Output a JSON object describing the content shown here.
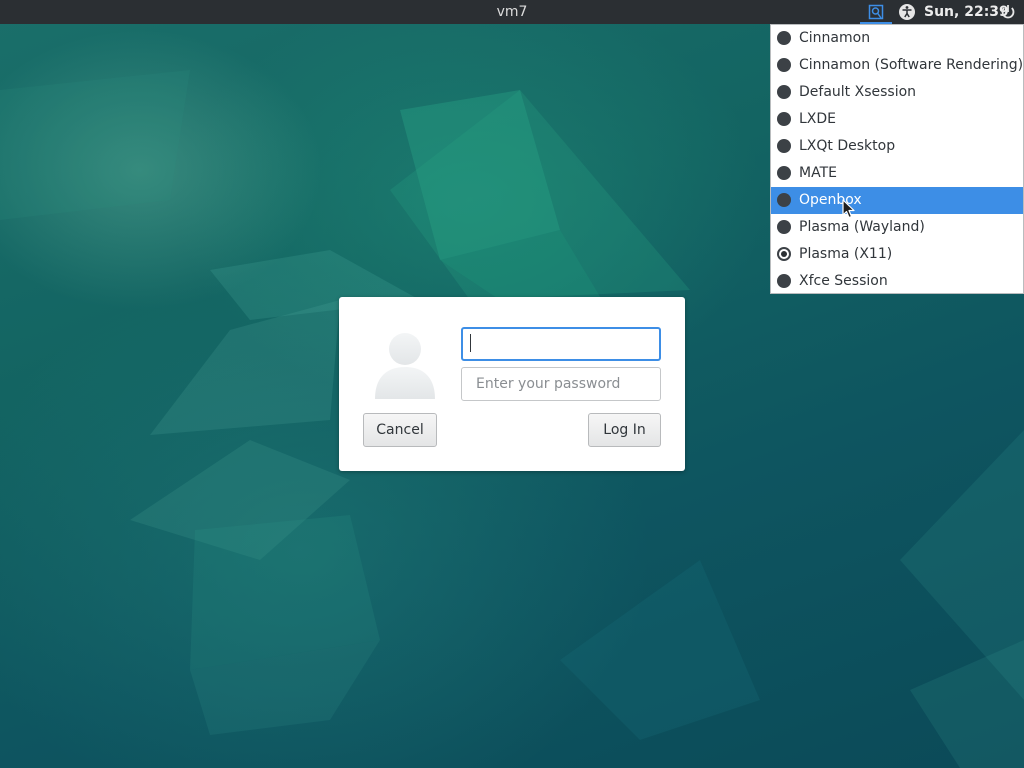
{
  "top_panel": {
    "hostname": "vm7",
    "clock": "Sun, 22:39",
    "icons": [
      "session-chooser-icon",
      "accessibility-icon",
      "power-icon"
    ]
  },
  "session_menu": {
    "items": [
      {
        "label": "Cinnamon",
        "checked": false,
        "highlighted": false
      },
      {
        "label": "Cinnamon (Software Rendering)",
        "checked": false,
        "highlighted": false
      },
      {
        "label": "Default Xsession",
        "checked": false,
        "highlighted": false
      },
      {
        "label": "LXDE",
        "checked": false,
        "highlighted": false
      },
      {
        "label": "LXQt Desktop",
        "checked": false,
        "highlighted": false
      },
      {
        "label": "MATE",
        "checked": false,
        "highlighted": false
      },
      {
        "label": "Openbox",
        "checked": false,
        "highlighted": true
      },
      {
        "label": "Plasma (Wayland)",
        "checked": false,
        "highlighted": false
      },
      {
        "label": "Plasma (X11)",
        "checked": true,
        "highlighted": false
      },
      {
        "label": "Xfce Session",
        "checked": false,
        "highlighted": false
      }
    ]
  },
  "login": {
    "username_value": "",
    "password_placeholder": "Enter your password",
    "cancel_label": "Cancel",
    "login_label": "Log In"
  },
  "colors": {
    "accent": "#3d8ee6",
    "panel": "#2b2f33",
    "desktop": "#136462"
  }
}
